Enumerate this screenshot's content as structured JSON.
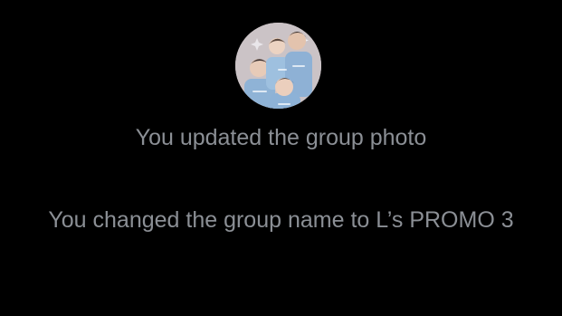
{
  "group_photo": {
    "icon": "group-photo-avatar",
    "background_color": "#c9c1c4"
  },
  "events": [
    {
      "text": "You updated the group photo"
    },
    {
      "text": "You changed the group name to L’s PROMO 3"
    }
  ],
  "colors": {
    "background": "#000000",
    "system_text": "#8b8f95"
  }
}
